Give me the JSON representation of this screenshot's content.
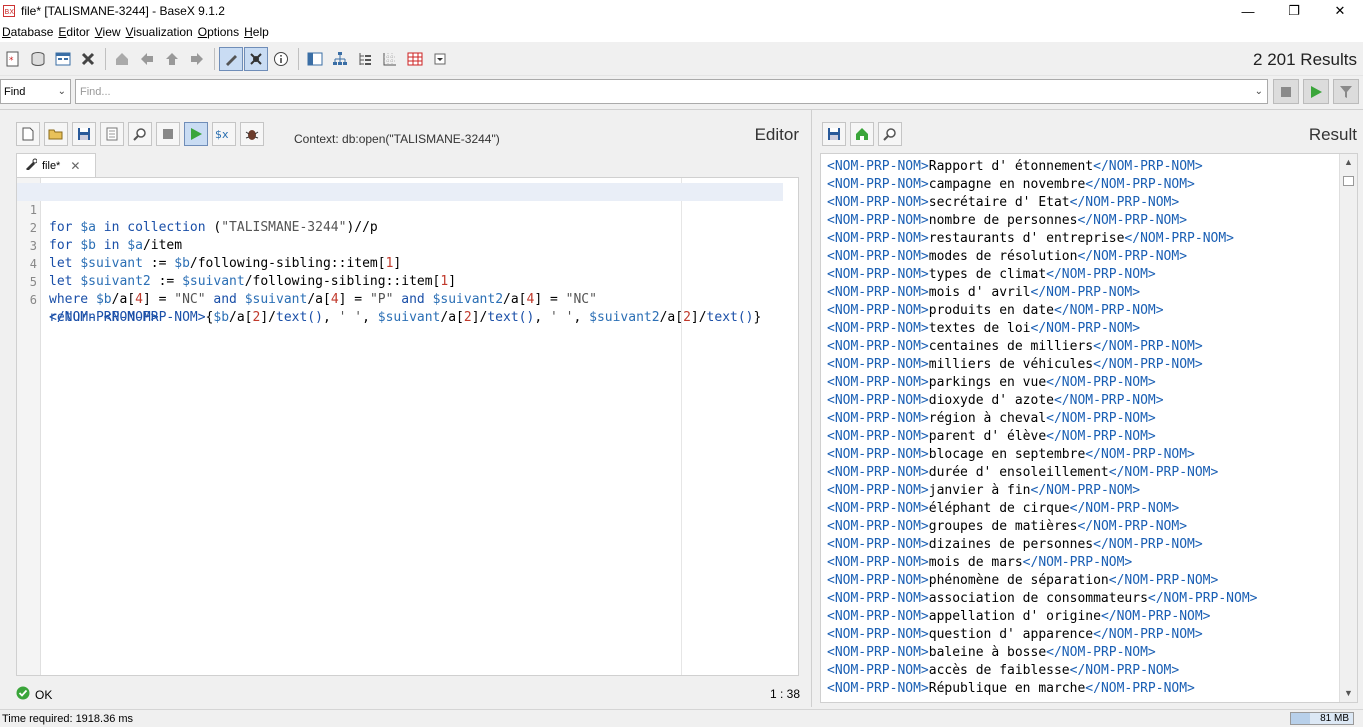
{
  "window": {
    "title": "file* [TALISMANE-3244] - BaseX 9.1.2",
    "minimize": "—",
    "maximize": "❐",
    "close": "✕"
  },
  "menu": [
    {
      "first": "D",
      "rest": "atabase"
    },
    {
      "first": "E",
      "rest": "ditor"
    },
    {
      "first": "V",
      "rest": "iew"
    },
    {
      "first": "V",
      "rest": "isualization"
    },
    {
      "first": "O",
      "rest": "ptions"
    },
    {
      "first": "H",
      "rest": "elp"
    }
  ],
  "toolbar": {
    "results": "2 201 Results"
  },
  "find": {
    "mode": "Find",
    "placeholder": "Find..."
  },
  "editor": {
    "title": "Editor",
    "context": "Context: db:open(\"TALISMANE-3244\")",
    "tab_label": "file*",
    "status": "OK",
    "position": "1 : 38",
    "lines": [
      "for $a in collection (\"TALISMANE-3244\")//p",
      "for $b in $a/item",
      "let $suivant := $b/following-sibling::item[1]",
      "let $suivant2 := $suivant/following-sibling::item[1]",
      "where $b/a[4] = \"NC\" and $suivant/a[4] = \"P\" and $suivant2/a[4] = \"NC\"",
      "return <NOM-PRP-NOM>{$b/a[2]/text(), ' ', $suivant/a[2]/text(), ' ', $suivant2/a[2]/text()}",
      "</NOM-PRP-NOM>"
    ],
    "line_numbers": [
      "1",
      "2",
      "3",
      "4",
      "5",
      "6"
    ]
  },
  "result": {
    "title": "Result",
    "open_tag": "<NOM-PRP-NOM>",
    "close_tag": "</NOM-PRP-NOM>",
    "items": [
      "Rapport d' étonnement",
      "campagne en novembre",
      "secrétaire d' Etat",
      "nombre de personnes",
      "restaurants d' entreprise",
      "modes de résolution",
      "types de climat",
      "mois d' avril",
      "produits en date",
      "textes de loi",
      "centaines de milliers",
      "milliers de véhicules",
      "parkings en vue",
      "dioxyde d' azote",
      "région à cheval",
      "parent d' élève",
      "blocage en septembre",
      "durée d' ensoleillement",
      "janvier à fin",
      "éléphant de cirque",
      "groupes de matières",
      "dizaines de personnes",
      "mois de mars",
      "phénomène de séparation",
      "association de consommateurs",
      "appellation d' origine",
      "question d' apparence",
      "baleine à bosse",
      "accès de faiblesse",
      "République en marche"
    ]
  },
  "statusbar": {
    "time": "Time required: 1918.36 ms",
    "memory": "81 MB",
    "memory_fraction": 0.3
  },
  "colors": {
    "keyword": "#1a4fa8",
    "tag": "#1a5fb4",
    "number": "#c0392b",
    "ok": "#3aa53a"
  }
}
